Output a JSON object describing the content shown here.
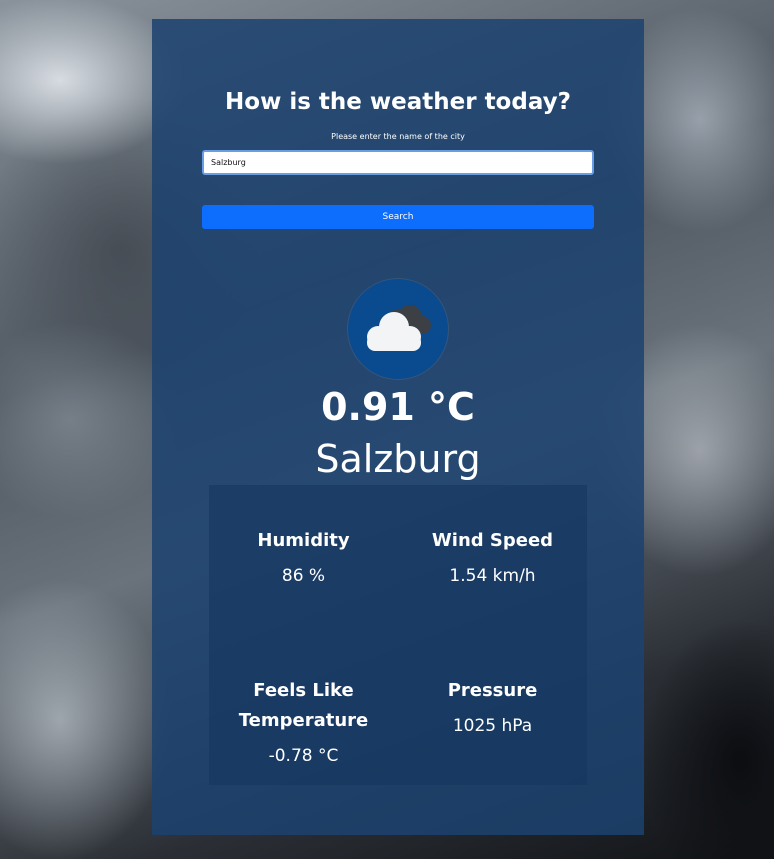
{
  "header": {
    "title": "How is the weather today?"
  },
  "search": {
    "label": "Please enter the name of the city",
    "value": "Salzburg",
    "button_label": "Search"
  },
  "current": {
    "icon": "cloudy-icon",
    "temperature": "0.91 °C",
    "city": "Salzburg"
  },
  "details": {
    "humidity": {
      "label": "Humidity",
      "value": "86 %"
    },
    "wind": {
      "label": "Wind Speed",
      "value": "1.54 km/h"
    },
    "feels_like": {
      "label": "Feels Like Temperature",
      "value": "-0.78 °C"
    },
    "pressure": {
      "label": "Pressure",
      "value": "1025 hPa"
    }
  },
  "colors": {
    "card": "#1c4270",
    "button": "#0d6efd",
    "icon_circle": "#0a4a8f"
  }
}
